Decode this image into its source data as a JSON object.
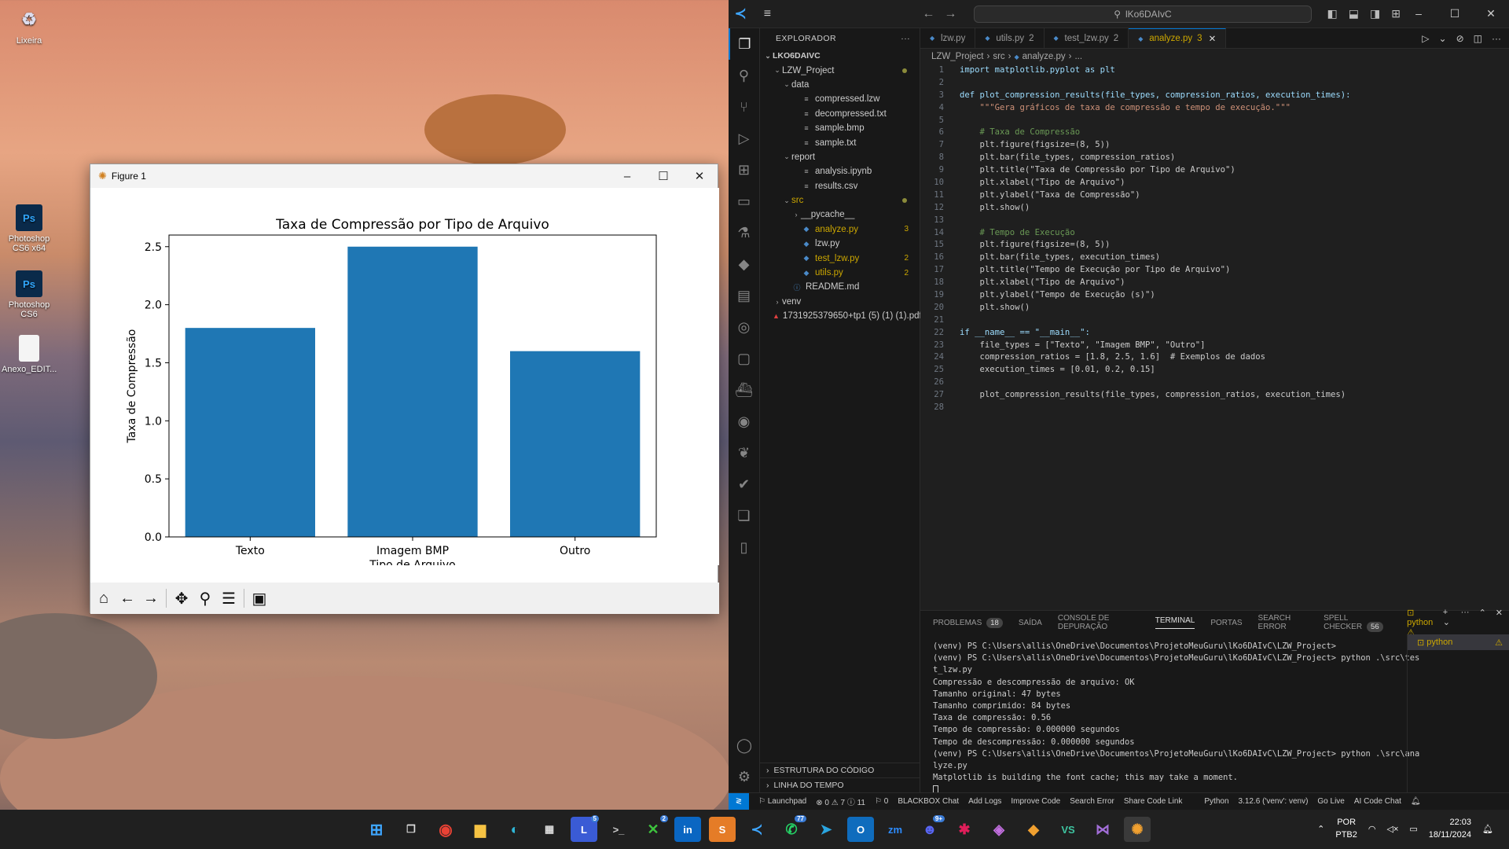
{
  "desktop": {
    "icons": [
      {
        "label": "Lixeira",
        "icon": "recycle-bin-icon"
      },
      {
        "label": "Photoshop CS6 x64",
        "icon": "photoshop-icon"
      },
      {
        "label": "Photoshop CS6",
        "icon": "photoshop-icon"
      },
      {
        "label": "Anexo_EDIT...",
        "icon": "document-icon"
      }
    ]
  },
  "figure": {
    "window_title": "Figure 1",
    "toolbar": [
      "home-icon",
      "back-icon",
      "forward-icon",
      "pan-icon",
      "zoom-icon",
      "configure-icon",
      "save-icon"
    ]
  },
  "chart_data": {
    "type": "bar",
    "title": "Taxa de Compressão por Tipo de Arquivo",
    "xlabel": "Tipo de Arquivo",
    "ylabel": "Taxa de Compressão",
    "categories": [
      "Texto",
      "Imagem BMP",
      "Outro"
    ],
    "values": [
      1.8,
      2.5,
      1.6
    ],
    "ylim": [
      0,
      2.6
    ],
    "yticks": [
      "0.0",
      "0.5",
      "1.0",
      "1.5",
      "2.0",
      "2.5"
    ],
    "bar_color": "#1f77b4",
    "grid": false
  },
  "vscode": {
    "search_text": "lKo6DAIvC",
    "explorer": {
      "header": "EXPLORADOR",
      "root": "LKO6DAIVC",
      "rows": [
        {
          "label": "LZW_Project",
          "level": 1,
          "kind": "folder-open",
          "dot": true
        },
        {
          "label": "data",
          "level": 2,
          "kind": "folder-open"
        },
        {
          "label": "compressed.lzw",
          "level": 3,
          "kind": "file"
        },
        {
          "label": "decompressed.txt",
          "level": 3,
          "kind": "file"
        },
        {
          "label": "sample.bmp",
          "level": 3,
          "kind": "file"
        },
        {
          "label": "sample.txt",
          "level": 3,
          "kind": "file"
        },
        {
          "label": "report",
          "level": 2,
          "kind": "folder-open"
        },
        {
          "label": "analysis.ipynb",
          "level": 3,
          "kind": "file"
        },
        {
          "label": "results.csv",
          "level": 3,
          "kind": "file"
        },
        {
          "label": "src",
          "level": 2,
          "kind": "folder-open",
          "dot": true,
          "warn": true
        },
        {
          "label": "__pycache__",
          "level": 3,
          "kind": "folder"
        },
        {
          "label": "analyze.py",
          "level": 3,
          "kind": "py",
          "badge": "3",
          "warn": true
        },
        {
          "label": "lzw.py",
          "level": 3,
          "kind": "py"
        },
        {
          "label": "test_lzw.py",
          "level": 3,
          "kind": "py",
          "badge": "2",
          "warn": true
        },
        {
          "label": "utils.py",
          "level": 3,
          "kind": "py",
          "badge": "2",
          "warn": true
        },
        {
          "label": "README.md",
          "level": 2,
          "kind": "info"
        },
        {
          "label": "venv",
          "level": 1,
          "kind": "folder"
        },
        {
          "label": "1731925379650+tp1 (5) (1) (1).pdf",
          "level": 1,
          "kind": "pdf"
        }
      ],
      "outline": "ESTRUTURA DO CÓDIGO",
      "timeline": "LINHA DO TEMPO"
    },
    "tabs": [
      {
        "label": "lzw.py",
        "num": ""
      },
      {
        "label": "utils.py",
        "num": "2"
      },
      {
        "label": "test_lzw.py",
        "num": "2"
      },
      {
        "label": "analyze.py",
        "num": "3",
        "active": true
      }
    ],
    "breadcrumb": [
      "LZW_Project",
      "src",
      "analyze.py",
      "..."
    ],
    "code_lines": [
      "import matplotlib.pyplot as plt",
      "",
      "def plot_compression_results(file_types, compression_ratios, execution_times):",
      "    \"\"\"Gera gráficos de taxa de compressão e tempo de execução.\"\"\"",
      "",
      "    # Taxa de Compressão",
      "    plt.figure(figsize=(8, 5))",
      "    plt.bar(file_types, compression_ratios)",
      "    plt.title(\"Taxa de Compressão por Tipo de Arquivo\")",
      "    plt.xlabel(\"Tipo de Arquivo\")",
      "    plt.ylabel(\"Taxa de Compressão\")",
      "    plt.show()",
      "",
      "    # Tempo de Execução",
      "    plt.figure(figsize=(8, 5))",
      "    plt.bar(file_types, execution_times)",
      "    plt.title(\"Tempo de Execução por Tipo de Arquivo\")",
      "    plt.xlabel(\"Tipo de Arquivo\")",
      "    plt.ylabel(\"Tempo de Execução (s)\")",
      "    plt.show()",
      "",
      "if __name__ == \"__main__\":",
      "    file_types = [\"Texto\", \"Imagem BMP\", \"Outro\"]",
      "    compression_ratios = [1.8, 2.5, 1.6]  # Exemplos de dados",
      "    execution_times = [0.01, 0.2, 0.15]",
      "",
      "    plot_compression_results(file_types, compression_ratios, execution_times)",
      ""
    ],
    "panel": {
      "tabs": [
        {
          "label": "PROBLEMAS",
          "count": "18"
        },
        {
          "label": "SAÍDA"
        },
        {
          "label": "CONSOLE DE DEPURAÇÃO"
        },
        {
          "label": "TERMINAL",
          "active": true
        },
        {
          "label": "PORTAS"
        },
        {
          "label": "SEARCH ERROR"
        },
        {
          "label": "SPELL CHECKER",
          "count": "56"
        }
      ],
      "terminal_name": "python",
      "terminal_lines": [
        "(venv) PS C:\\Users\\allis\\OneDrive\\Documentos\\ProjetoMeuGuru\\lKo6DAIvC\\LZW_Project>",
        "(venv) PS C:\\Users\\allis\\OneDrive\\Documentos\\ProjetoMeuGuru\\lKo6DAIvC\\LZW_Project> python .\\src\\tes",
        "t_lzw.py",
        "Compressão e descompressão de arquivo: OK",
        "Tamanho original: 47 bytes",
        "Tamanho comprimido: 84 bytes",
        "Taxa de compressão: 0.56",
        "Tempo de compressão: 0.000000 segundos",
        "Tempo de descompressão: 0.000000 segundos",
        "(venv) PS C:\\Users\\allis\\OneDrive\\Documentos\\ProjetoMeuGuru\\lKo6DAIvC\\LZW_Project> python .\\src\\ana",
        "lyze.py",
        "Matplotlib is building the font cache; this may take a moment."
      ]
    },
    "status": {
      "launchpad": "Launchpad",
      "problems": "⊗ 0 ⚠ 7 ⓘ 11",
      "ports": "⚐ 0",
      "items": [
        "BLACKBOX Chat",
        "Add Logs",
        "Improve Code",
        "Search Error",
        "Share Code Link"
      ],
      "right": [
        "Python",
        "3.12.6 ('venv': venv)",
        "Go Live",
        "AI Code Chat"
      ]
    }
  },
  "taskbar": {
    "badges": {
      "linkedin": "5",
      "xbox": "2",
      "whatsapp": "77",
      "discord": "9+"
    },
    "lang": "POR",
    "layout": "PTB2",
    "time": "22:03",
    "date": "18/11/2024"
  }
}
